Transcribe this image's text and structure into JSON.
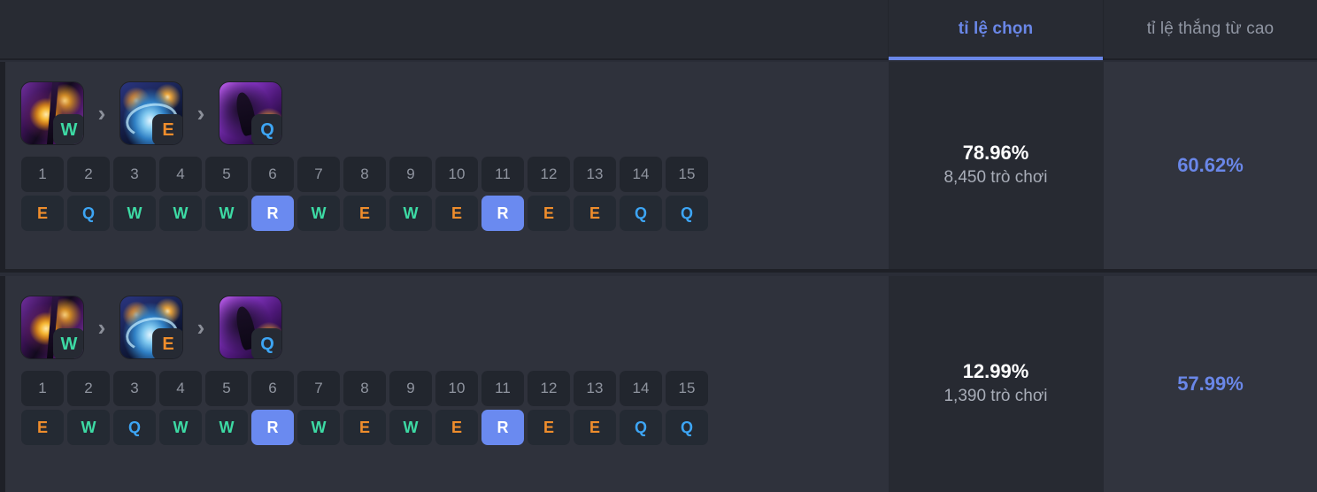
{
  "header": {
    "tabs": [
      {
        "label": "tỉ lệ chọn",
        "active": true
      },
      {
        "label": "tỉ lệ thắng từ cao",
        "active": false
      }
    ]
  },
  "rows": [
    {
      "abilities": [
        {
          "key": "W",
          "art": "w"
        },
        {
          "key": "E",
          "art": "e"
        },
        {
          "key": "Q",
          "art": "q"
        }
      ],
      "separator": "›",
      "levels": [
        "1",
        "2",
        "3",
        "4",
        "5",
        "6",
        "7",
        "8",
        "9",
        "10",
        "11",
        "12",
        "13",
        "14",
        "15"
      ],
      "skills": [
        "E",
        "Q",
        "W",
        "W",
        "W",
        "R",
        "W",
        "E",
        "W",
        "E",
        "R",
        "E",
        "E",
        "Q",
        "Q"
      ],
      "pick_rate": "78.96%",
      "games": "8,450 trò chơi",
      "win_rate": "60.62%"
    },
    {
      "abilities": [
        {
          "key": "W",
          "art": "w"
        },
        {
          "key": "E",
          "art": "e"
        },
        {
          "key": "Q",
          "art": "q"
        }
      ],
      "separator": "›",
      "levels": [
        "1",
        "2",
        "3",
        "4",
        "5",
        "6",
        "7",
        "8",
        "9",
        "10",
        "11",
        "12",
        "13",
        "14",
        "15"
      ],
      "skills": [
        "E",
        "W",
        "Q",
        "W",
        "W",
        "R",
        "W",
        "E",
        "W",
        "E",
        "R",
        "E",
        "E",
        "Q",
        "Q"
      ],
      "pick_rate": "12.99%",
      "games": "1,390 trò chơi",
      "win_rate": "57.99%"
    }
  ],
  "colors": {
    "accent": "#6a87e8",
    "skill_q": "#3da5f4",
    "skill_w": "#3ddaa4",
    "skill_e": "#ef8d2c",
    "skill_r_bg": "#6a8af0",
    "page_bg": "#2f323c"
  }
}
